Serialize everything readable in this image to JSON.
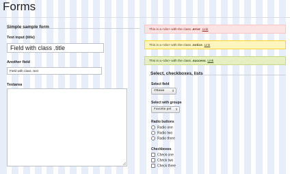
{
  "page": {
    "title": "Forms"
  },
  "left_form": {
    "legend": "Simple sample form",
    "fields": [
      {
        "label": "Text input (title)",
        "value": "Field with class .title"
      },
      {
        "label": "Another field",
        "value": "Field with class .text"
      },
      {
        "label": "Textarea",
        "value": ""
      }
    ]
  },
  "messages": [
    {
      "type": "error",
      "prefix": "This is a <div> with the class ",
      "cls": ".error",
      "suffix": ". ",
      "link": "Link"
    },
    {
      "type": "notice",
      "prefix": "This is a <div> with the class ",
      "cls": ".notice",
      "suffix": ". ",
      "link": "Link"
    },
    {
      "type": "success",
      "prefix": "This is a <div> with the class ",
      "cls": ".success",
      "suffix": ". ",
      "link": "Link"
    }
  ],
  "right_form": {
    "legend": "Select, checkboxes, lists",
    "select_field": {
      "label": "Select field",
      "selected": "Ottawa"
    },
    "select_groups": {
      "label": "Select with groups",
      "selected": "Favorite pet"
    },
    "radio": {
      "label": "Radio buttons",
      "options": [
        "Radio one",
        "Radio two",
        "Radio three"
      ]
    },
    "checkboxes": {
      "label": "Checkboxes",
      "options": [
        "Check one",
        "Check two",
        "Check three"
      ]
    }
  },
  "colors": {
    "error_bg": "#fbe3e4",
    "notice_bg": "#fff6bf",
    "success_bg": "#e6efc2",
    "grid_stripe": "#e8eef9"
  }
}
